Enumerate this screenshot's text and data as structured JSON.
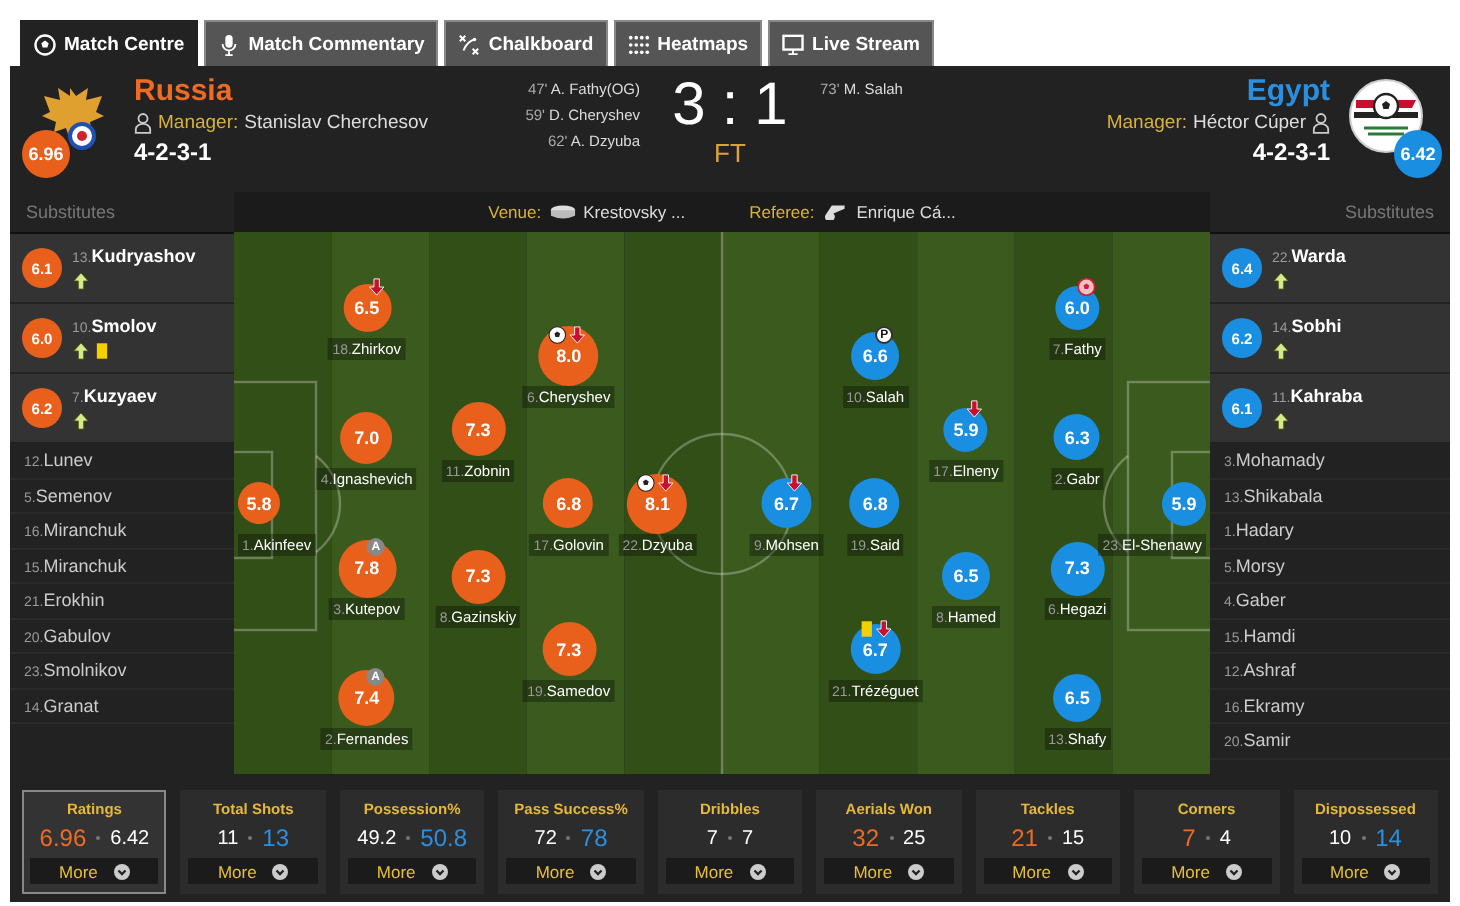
{
  "tabs": [
    {
      "label": "Match Centre",
      "kind": "ball",
      "selected": true
    },
    {
      "label": "Match Commentary",
      "kind": "mic",
      "selected": false
    },
    {
      "label": "Chalkboard",
      "kind": "chalk",
      "selected": false
    },
    {
      "label": "Heatmaps",
      "kind": "dots",
      "selected": false
    },
    {
      "label": "Live Stream",
      "kind": "screen",
      "selected": false
    }
  ],
  "home": {
    "name": "Russia",
    "manager_label": "Manager:",
    "manager": "Stanislav Cherchesov",
    "formation": "4-2-3-1",
    "rating": "6.96"
  },
  "away": {
    "name": "Egypt",
    "manager_label": "Manager:",
    "manager": "Héctor Cúper",
    "formation": "4-2-3-1",
    "rating": "6.42"
  },
  "home_goals": [
    {
      "minute": "47'",
      "player": "A. Fathy(OG)"
    },
    {
      "minute": "59'",
      "player": "D. Cheryshev"
    },
    {
      "minute": "62'",
      "player": "A. Dzyuba"
    }
  ],
  "away_goals": [
    {
      "minute": "73'",
      "player": "M. Salah"
    }
  ],
  "score": {
    "home": "3",
    "separator": ":",
    "away": "1",
    "status": "FT"
  },
  "match_info": {
    "venue_label": "Venue:",
    "venue": "Krestovsky ...",
    "referee_label": "Referee:",
    "referee": "Enrique Cá..."
  },
  "home_substitutes": {
    "title": "Substitutes",
    "players": [
      {
        "kind": "played",
        "number": "13.",
        "name": "Kudryashov",
        "rating": "6.1",
        "events": [
          {
            "kind": "sub_on"
          }
        ]
      },
      {
        "kind": "played",
        "number": "10.",
        "name": "Smolov",
        "rating": "6.0",
        "events": [
          {
            "kind": "sub_on"
          },
          {
            "kind": "yellow"
          }
        ]
      },
      {
        "kind": "played",
        "number": "7.",
        "name": "Kuzyaev",
        "rating": "6.2",
        "events": [
          {
            "kind": "sub_on"
          }
        ]
      },
      {
        "kind": "unused",
        "number": "12.",
        "name": "Lunev"
      },
      {
        "kind": "unused",
        "number": "5.",
        "name": "Semenov"
      },
      {
        "kind": "unused",
        "number": "16.",
        "name": "Miranchuk"
      },
      {
        "kind": "unused",
        "number": "15.",
        "name": "Miranchuk"
      },
      {
        "kind": "unused",
        "number": "21.",
        "name": "Erokhin"
      },
      {
        "kind": "unused",
        "number": "20.",
        "name": "Gabulov"
      },
      {
        "kind": "unused",
        "number": "23.",
        "name": "Smolnikov"
      },
      {
        "kind": "unused",
        "number": "14.",
        "name": "Granat"
      }
    ]
  },
  "away_substitutes": {
    "title": "Substitutes",
    "players": [
      {
        "kind": "played",
        "number": "22.",
        "name": "Warda",
        "rating": "6.4",
        "events": [
          {
            "kind": "sub_on"
          }
        ]
      },
      {
        "kind": "played",
        "number": "14.",
        "name": "Sobhi",
        "rating": "6.2",
        "events": [
          {
            "kind": "sub_on"
          }
        ]
      },
      {
        "kind": "played",
        "number": "11.",
        "name": "Kahraba",
        "rating": "6.1",
        "events": [
          {
            "kind": "sub_on"
          }
        ]
      },
      {
        "kind": "unused",
        "number": "3.",
        "name": "Mohamady"
      },
      {
        "kind": "unused",
        "number": "13.",
        "name": "Shikabala"
      },
      {
        "kind": "unused",
        "number": "1.",
        "name": "Hadary"
      },
      {
        "kind": "unused",
        "number": "5.",
        "name": "Morsy"
      },
      {
        "kind": "unused",
        "number": "4.",
        "name": "Gaber"
      },
      {
        "kind": "unused",
        "number": "15.",
        "name": "Hamdi"
      },
      {
        "kind": "unused",
        "number": "12.",
        "name": "Ashraf"
      },
      {
        "kind": "unused",
        "number": "16.",
        "name": "Ekramy"
      },
      {
        "kind": "unused",
        "number": "20.",
        "name": "Samir"
      }
    ]
  },
  "pitch": {
    "home_lines": [
      {
        "players": [
          {
            "number": "1.",
            "name": "Akinfeev",
            "rating": "5.8"
          }
        ]
      },
      {
        "players": [
          {
            "number": "18.",
            "name": "Zhirkov",
            "rating": "6.5",
            "events": [
              {
                "kind": "sub_off"
              }
            ]
          },
          {
            "number": "4.",
            "name": "Ignashevich",
            "rating": "7.0"
          },
          {
            "number": "3.",
            "name": "Kutepov",
            "rating": "7.8",
            "events": [
              {
                "kind": "assist",
                "label": "A"
              }
            ]
          },
          {
            "number": "2.",
            "name": "Fernandes",
            "rating": "7.4",
            "events": [
              {
                "kind": "assist",
                "label": "A"
              }
            ]
          }
        ]
      },
      {
        "players": [
          {
            "number": "11.",
            "name": "Zobnin",
            "rating": "7.3"
          },
          {
            "number": "8.",
            "name": "Gazinskiy",
            "rating": "7.3"
          }
        ]
      },
      {
        "players": [
          {
            "number": "6.",
            "name": "Cheryshev",
            "rating": "8.0",
            "events": [
              {
                "kind": "goal"
              },
              {
                "kind": "sub_off"
              }
            ]
          },
          {
            "number": "17.",
            "name": "Golovin",
            "rating": "6.8"
          },
          {
            "number": "19.",
            "name": "Samedov",
            "rating": "7.3"
          }
        ]
      },
      {
        "players": [
          {
            "number": "22.",
            "name": "Dzyuba",
            "rating": "8.1",
            "events": [
              {
                "kind": "goal"
              },
              {
                "kind": "sub_off"
              }
            ]
          }
        ]
      }
    ],
    "away_lines": [
      {
        "players": [
          {
            "number": "9.",
            "name": "Mohsen",
            "rating": "6.7",
            "events": [
              {
                "kind": "sub_off"
              }
            ]
          }
        ]
      },
      {
        "players": [
          {
            "number": "10.",
            "name": "Salah",
            "rating": "6.6",
            "events": [
              {
                "kind": "penalty_goal",
                "label": "P"
              }
            ]
          },
          {
            "number": "19.",
            "name": "Said",
            "rating": "6.8"
          },
          {
            "number": "21.",
            "name": "Trézéguet",
            "rating": "6.7",
            "events": [
              {
                "kind": "yellow"
              },
              {
                "kind": "sub_off"
              }
            ]
          }
        ]
      },
      {
        "players": [
          {
            "number": "17.",
            "name": "Elneny",
            "rating": "5.9",
            "events": [
              {
                "kind": "sub_off"
              }
            ]
          },
          {
            "number": "8.",
            "name": "Hamed",
            "rating": "6.5"
          }
        ]
      },
      {
        "players": [
          {
            "number": "7.",
            "name": "Fathy",
            "rating": "6.0",
            "events": [
              {
                "kind": "own_goal"
              }
            ]
          },
          {
            "number": "2.",
            "name": "Gabr",
            "rating": "6.3"
          },
          {
            "number": "6.",
            "name": "Hegazi",
            "rating": "7.3"
          },
          {
            "number": "13.",
            "name": "Shafy",
            "rating": "6.5"
          }
        ]
      },
      {
        "players": [
          {
            "number": "23.",
            "name": "El-Shenawy",
            "rating": "5.9"
          }
        ]
      }
    ]
  },
  "stats": [
    {
      "title": "Ratings",
      "home": "6.96",
      "away": "6.42",
      "home_leads": true,
      "away_leads": false,
      "selected": true,
      "button": "More"
    },
    {
      "title": "Total Shots",
      "home": "11",
      "away": "13",
      "home_leads": false,
      "away_leads": true,
      "selected": false,
      "button": "More"
    },
    {
      "title": "Possession%",
      "home": "49.2",
      "away": "50.8",
      "home_leads": false,
      "away_leads": true,
      "selected": false,
      "button": "More"
    },
    {
      "title": "Pass Success%",
      "home": "72",
      "away": "78",
      "home_leads": false,
      "away_leads": true,
      "selected": false,
      "button": "More"
    },
    {
      "title": "Dribbles",
      "home": "7",
      "away": "7",
      "home_leads": false,
      "away_leads": false,
      "selected": false,
      "button": "More"
    },
    {
      "title": "Aerials Won",
      "home": "32",
      "away": "25",
      "home_leads": true,
      "away_leads": false,
      "selected": false,
      "button": "More"
    },
    {
      "title": "Tackles",
      "home": "21",
      "away": "15",
      "home_leads": true,
      "away_leads": false,
      "selected": false,
      "button": "More"
    },
    {
      "title": "Corners",
      "home": "7",
      "away": "4",
      "home_leads": true,
      "away_leads": false,
      "selected": false,
      "button": "More"
    },
    {
      "title": "Dispossessed",
      "home": "10",
      "away": "14",
      "home_leads": false,
      "away_leads": true,
      "selected": false,
      "button": "More"
    }
  ]
}
